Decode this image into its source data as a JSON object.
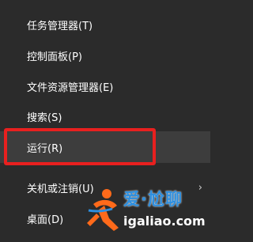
{
  "menu": {
    "items": [
      {
        "label": "任务管理器(T)"
      },
      {
        "label": "控制面板(P)"
      },
      {
        "label": "文件资源管理器(E)"
      },
      {
        "label": "搜索(S)"
      },
      {
        "label": "运行(R)"
      },
      {
        "label": "关机或注销(U)"
      },
      {
        "label": "桌面(D)"
      }
    ]
  },
  "watermark": {
    "title": "爱·尬聊",
    "url": "igaliao.com"
  },
  "colors": {
    "background": "#2b2b2b",
    "highlight_border": "#e8201f",
    "text": "#ffffff",
    "watermark_blue": "#2d8fe0"
  }
}
